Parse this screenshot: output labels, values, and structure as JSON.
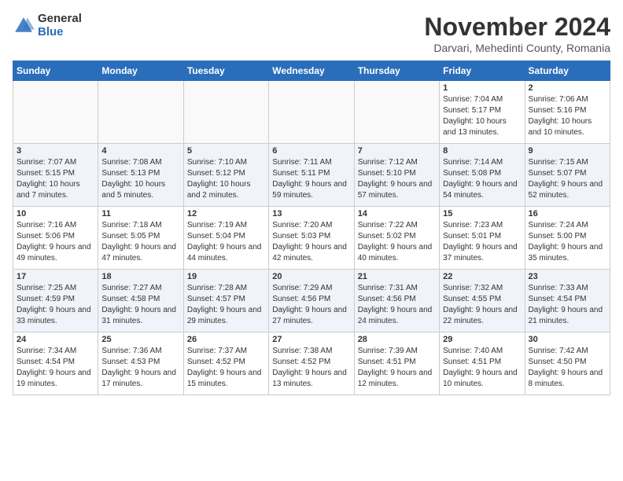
{
  "header": {
    "logo_general": "General",
    "logo_blue": "Blue",
    "month_title": "November 2024",
    "location": "Darvari, Mehedinti County, Romania"
  },
  "days_of_week": [
    "Sunday",
    "Monday",
    "Tuesday",
    "Wednesday",
    "Thursday",
    "Friday",
    "Saturday"
  ],
  "weeks": [
    [
      {
        "day": "",
        "info": ""
      },
      {
        "day": "",
        "info": ""
      },
      {
        "day": "",
        "info": ""
      },
      {
        "day": "",
        "info": ""
      },
      {
        "day": "",
        "info": ""
      },
      {
        "day": "1",
        "info": "Sunrise: 7:04 AM\nSunset: 5:17 PM\nDaylight: 10 hours and 13 minutes."
      },
      {
        "day": "2",
        "info": "Sunrise: 7:06 AM\nSunset: 5:16 PM\nDaylight: 10 hours and 10 minutes."
      }
    ],
    [
      {
        "day": "3",
        "info": "Sunrise: 7:07 AM\nSunset: 5:15 PM\nDaylight: 10 hours and 7 minutes."
      },
      {
        "day": "4",
        "info": "Sunrise: 7:08 AM\nSunset: 5:13 PM\nDaylight: 10 hours and 5 minutes."
      },
      {
        "day": "5",
        "info": "Sunrise: 7:10 AM\nSunset: 5:12 PM\nDaylight: 10 hours and 2 minutes."
      },
      {
        "day": "6",
        "info": "Sunrise: 7:11 AM\nSunset: 5:11 PM\nDaylight: 9 hours and 59 minutes."
      },
      {
        "day": "7",
        "info": "Sunrise: 7:12 AM\nSunset: 5:10 PM\nDaylight: 9 hours and 57 minutes."
      },
      {
        "day": "8",
        "info": "Sunrise: 7:14 AM\nSunset: 5:08 PM\nDaylight: 9 hours and 54 minutes."
      },
      {
        "day": "9",
        "info": "Sunrise: 7:15 AM\nSunset: 5:07 PM\nDaylight: 9 hours and 52 minutes."
      }
    ],
    [
      {
        "day": "10",
        "info": "Sunrise: 7:16 AM\nSunset: 5:06 PM\nDaylight: 9 hours and 49 minutes."
      },
      {
        "day": "11",
        "info": "Sunrise: 7:18 AM\nSunset: 5:05 PM\nDaylight: 9 hours and 47 minutes."
      },
      {
        "day": "12",
        "info": "Sunrise: 7:19 AM\nSunset: 5:04 PM\nDaylight: 9 hours and 44 minutes."
      },
      {
        "day": "13",
        "info": "Sunrise: 7:20 AM\nSunset: 5:03 PM\nDaylight: 9 hours and 42 minutes."
      },
      {
        "day": "14",
        "info": "Sunrise: 7:22 AM\nSunset: 5:02 PM\nDaylight: 9 hours and 40 minutes."
      },
      {
        "day": "15",
        "info": "Sunrise: 7:23 AM\nSunset: 5:01 PM\nDaylight: 9 hours and 37 minutes."
      },
      {
        "day": "16",
        "info": "Sunrise: 7:24 AM\nSunset: 5:00 PM\nDaylight: 9 hours and 35 minutes."
      }
    ],
    [
      {
        "day": "17",
        "info": "Sunrise: 7:25 AM\nSunset: 4:59 PM\nDaylight: 9 hours and 33 minutes."
      },
      {
        "day": "18",
        "info": "Sunrise: 7:27 AM\nSunset: 4:58 PM\nDaylight: 9 hours and 31 minutes."
      },
      {
        "day": "19",
        "info": "Sunrise: 7:28 AM\nSunset: 4:57 PM\nDaylight: 9 hours and 29 minutes."
      },
      {
        "day": "20",
        "info": "Sunrise: 7:29 AM\nSunset: 4:56 PM\nDaylight: 9 hours and 27 minutes."
      },
      {
        "day": "21",
        "info": "Sunrise: 7:31 AM\nSunset: 4:56 PM\nDaylight: 9 hours and 24 minutes."
      },
      {
        "day": "22",
        "info": "Sunrise: 7:32 AM\nSunset: 4:55 PM\nDaylight: 9 hours and 22 minutes."
      },
      {
        "day": "23",
        "info": "Sunrise: 7:33 AM\nSunset: 4:54 PM\nDaylight: 9 hours and 21 minutes."
      }
    ],
    [
      {
        "day": "24",
        "info": "Sunrise: 7:34 AM\nSunset: 4:54 PM\nDaylight: 9 hours and 19 minutes."
      },
      {
        "day": "25",
        "info": "Sunrise: 7:36 AM\nSunset: 4:53 PM\nDaylight: 9 hours and 17 minutes."
      },
      {
        "day": "26",
        "info": "Sunrise: 7:37 AM\nSunset: 4:52 PM\nDaylight: 9 hours and 15 minutes."
      },
      {
        "day": "27",
        "info": "Sunrise: 7:38 AM\nSunset: 4:52 PM\nDaylight: 9 hours and 13 minutes."
      },
      {
        "day": "28",
        "info": "Sunrise: 7:39 AM\nSunset: 4:51 PM\nDaylight: 9 hours and 12 minutes."
      },
      {
        "day": "29",
        "info": "Sunrise: 7:40 AM\nSunset: 4:51 PM\nDaylight: 9 hours and 10 minutes."
      },
      {
        "day": "30",
        "info": "Sunrise: 7:42 AM\nSunset: 4:50 PM\nDaylight: 9 hours and 8 minutes."
      }
    ]
  ]
}
